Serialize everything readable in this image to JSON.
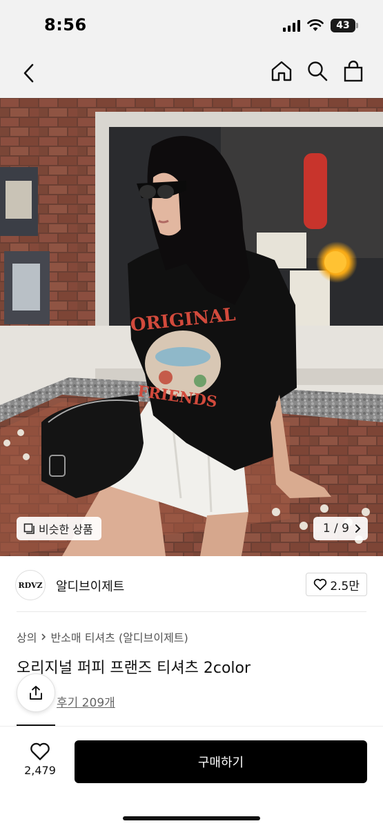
{
  "status_bar": {
    "time": "8:56",
    "battery": "43"
  },
  "nav": {
    "icons": [
      "chevron-left-icon",
      "home-icon",
      "search-icon",
      "shopping-bag-icon"
    ]
  },
  "gallery": {
    "similar_label": "비슷한 상품",
    "page_indicator": "1 / 9",
    "shirt_print_top": "ORIGINAL",
    "shirt_print_bottom": "FRIENDS"
  },
  "brand": {
    "name": "알디브이제트",
    "logo_text": "RDVZ",
    "likes": "2.5만"
  },
  "product": {
    "breadcrumb": [
      "상의",
      "반소매 티셔츠 (알디브이제트)"
    ],
    "title": "오리지널 퍼피 프랜즈 티셔츠 2color",
    "review_label": "후기 209개"
  },
  "bottom_bar": {
    "wish_count": "2,479",
    "buy_label": "구매하기"
  },
  "colors": {
    "accent": "#000000",
    "page_bg": "#ffffff",
    "header_bg": "#f2f2f2"
  }
}
